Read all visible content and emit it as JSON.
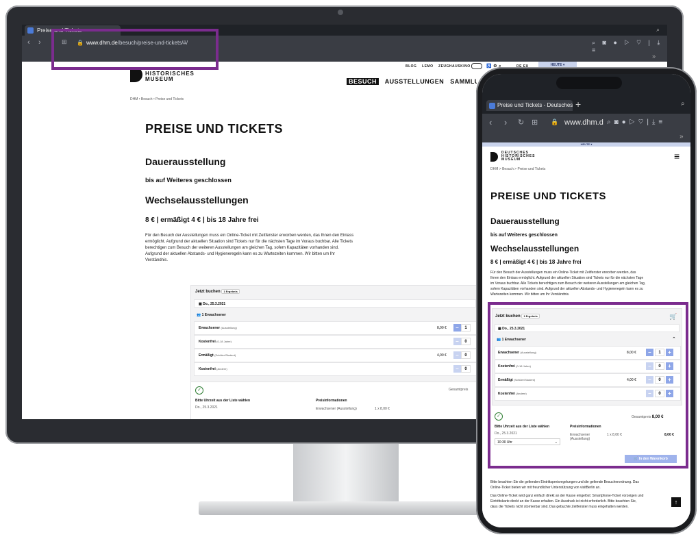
{
  "desktop": {
    "tab_title": "Preise und Tickets",
    "url_domain": "www.dhm.de",
    "url_path": "/besuch/preise-und-tickets/#/",
    "topnav_small": [
      "BLOG",
      "LEMO",
      "ZEUGHAUSKINO"
    ],
    "lang": "DE EU",
    "today": "HEUTE",
    "logo_line1": "HISTORISCHES",
    "logo_line2": "MUSEUM",
    "mainnav": [
      "BESUCH",
      "AUSSTELLUNGEN",
      "SAMMLUNG"
    ],
    "breadcrumb": "DHM • Besuch • Preise und Tickets",
    "title": "PREISE UND TICKETS",
    "dauer_heading": "Dauerausstellung",
    "dauer_status": "bis auf Weiteres geschlossen",
    "wechsel_heading": "Wechselausstellungen",
    "price_line": "8 € | ermäßigt 4 € | bis 18 Jahre frei",
    "para_lines": [
      "Für den Besuch der Ausstellungen muss ein Online-Ticket mit Zeitfenster erworben werden, das Ihnen den Einlass",
      "ermöglicht. Aufgrund der aktuellen Situation sind Tickets nur für die nächsten Tage im Voraus buchbar. Alle Tickets",
      "berechtigen zum Besuch der weiteren Ausstellungen am gleichen Tag, sofern Kapazitäten vorhanden sind.",
      "Aufgrund der aktuellen Abstands- und Hygieneregeln kann es zu Wartezeiten kommen. Wir bitten um Ihr",
      "Verständnis."
    ],
    "widget": {
      "title": "Jetzt buchen",
      "result_pill": "1 Ergebnis",
      "date": "Do., 25.3.2021",
      "persons": "1 Erwachsener",
      "rows": [
        {
          "label": "Erwachsener",
          "sub": "(Ausstellung)",
          "price": "8,00 €",
          "qty": "1"
        },
        {
          "label": "Kostenfrei",
          "sub": "(0-18 Jahre)",
          "price": "",
          "qty": "0"
        },
        {
          "label": "Ermäßigt",
          "sub": "(Schüler/Student)",
          "price": "4,00 €",
          "qty": "0"
        },
        {
          "label": "Kostenfrei",
          "sub": "(Andere)",
          "price": "",
          "qty": "0"
        }
      ],
      "total_label": "Gesamtpreis",
      "time_label": "Bitte Uhrzeit aus der Liste wählen",
      "time_date": "Do., 25.3.2021",
      "price_info_label": "Preisinformationen",
      "price_info_row": "Erwachsener (Ausstellung)",
      "price_info_calc": "1 x 8,00 €"
    }
  },
  "phone": {
    "tab_title": "Preise und Tickets - Deutsches",
    "url": "www.dhm.d",
    "today": "HEUTE",
    "logo_line1": "DEUTSCHES",
    "logo_line2": "HISTORISCHES",
    "logo_line3": "MUSEUM",
    "breadcrumb": "DHM > Besuch > Preise und Tickets",
    "title": "PREISE UND TICKETS",
    "dauer_heading": "Dauerausstellung",
    "dauer_status": "bis auf Weiteres geschlossen",
    "wechsel_heading": "Wechselausstellungen",
    "price_line": "8 € | ermäßigt 4 € | bis 18 Jahre frei",
    "para_lines": [
      "Für den Besuch der Ausstellungen muss ein Online-Ticket mit Zeitfenster erworben werden, das",
      "Ihnen den Einlass ermöglicht. Aufgrund der aktuellen Situation sind Tickets nur für die nächsten Tage",
      "im Voraus buchbar. Alle Tickets berechtigen zum Besuch der weiteren Ausstellungen am gleichen Tag,",
      "sofern Kapazitäten vorhanden sind. Aufgrund der aktuellen Abstands- und Hygieneregeln kann es zu",
      "Wartezeiten kommen. Wir bitten um Ihr Verständnis."
    ],
    "widget": {
      "title": "Jetzt buchen",
      "result_pill": "1 Ergebnis",
      "date": "Do., 25.3.2021",
      "persons": "1 Erwachsener",
      "rows": [
        {
          "label": "Erwachsener",
          "sub": "(Ausstellung)",
          "price": "8,00 €",
          "qty": "1"
        },
        {
          "label": "Kostenfrei",
          "sub": "(0-18 Jahre)",
          "price": "",
          "qty": "0"
        },
        {
          "label": "Ermäßigt",
          "sub": "(Schüler/Student)",
          "price": "4,00 €",
          "qty": "0"
        },
        {
          "label": "Kostenfrei",
          "sub": "(Andere)",
          "price": "",
          "qty": "0"
        }
      ],
      "total_label": "Gesamtpreis",
      "total_value": "8,00 €",
      "time_label": "Bitte Uhrzeit aus der Liste wählen",
      "time_date": "Do., 25.3.2021",
      "time_value": "10:30 Uhr",
      "price_info_label": "Preisinformationen",
      "price_info_row": "Erwachsener (Ausstellung)",
      "price_info_calc": "1 x 8,00 €",
      "price_info_sum": "8,00 €",
      "cart_button": "In den Warenkorb"
    },
    "footer_lines": [
      "Bitte beachten Sie die geltenden Eintrittspreisregelungen und die geltende Besucherordnung. Das",
      "Online-Ticket bieten wir mit freundlicher Unterstützung von visitBerlin an.",
      "Das Online-Ticket wird ganz einfach direkt an der Kasse eingelöst: Smartphone-Ticket vorzeigen und",
      "Eintrittskarte direkt an der Kasse erhalten. Ein Ausdruck ist nicht erforderlich. Bitte beachten Sie,",
      "dass die Tickets nicht stornierbar sind. Das gebuchte Zeitfenster muss eingehalten werden."
    ]
  },
  "colors": {
    "highlight": "#7b2c8e",
    "stepper": "#8ea6e8",
    "browser_dark": "#3a3d44"
  }
}
